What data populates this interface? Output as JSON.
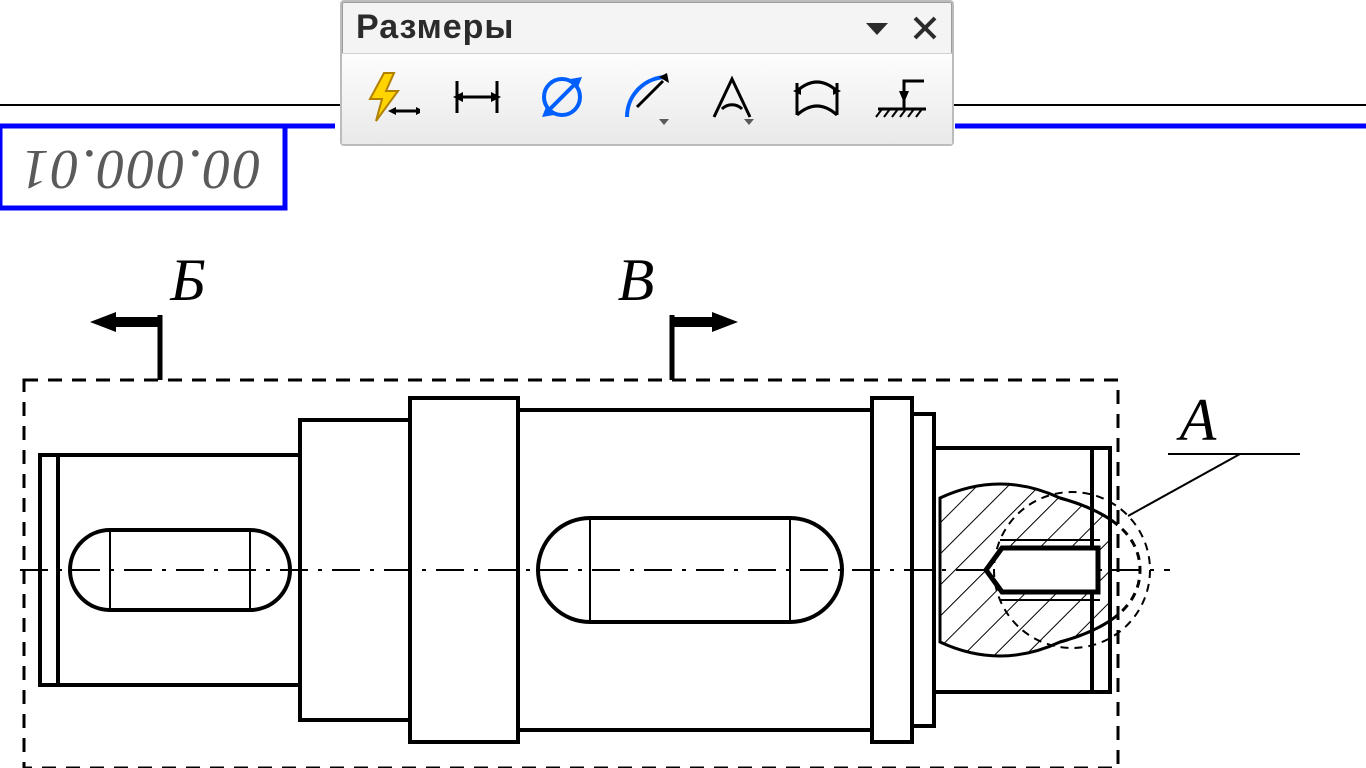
{
  "toolbar": {
    "title": "Размеры",
    "buttons": [
      {
        "name": "auto-dimension"
      },
      {
        "name": "linear-dimension"
      },
      {
        "name": "diameter-dimension"
      },
      {
        "name": "radial-dimension"
      },
      {
        "name": "angular-dimension"
      },
      {
        "name": "arc-dimension"
      },
      {
        "name": "height-dimension"
      }
    ]
  },
  "drawing": {
    "titleblock_number": "00.000.01",
    "section_labels": {
      "b": "Б",
      "v": "В",
      "a": "А"
    }
  },
  "colors": {
    "accent": "#0000ff",
    "ink": "#000000"
  }
}
